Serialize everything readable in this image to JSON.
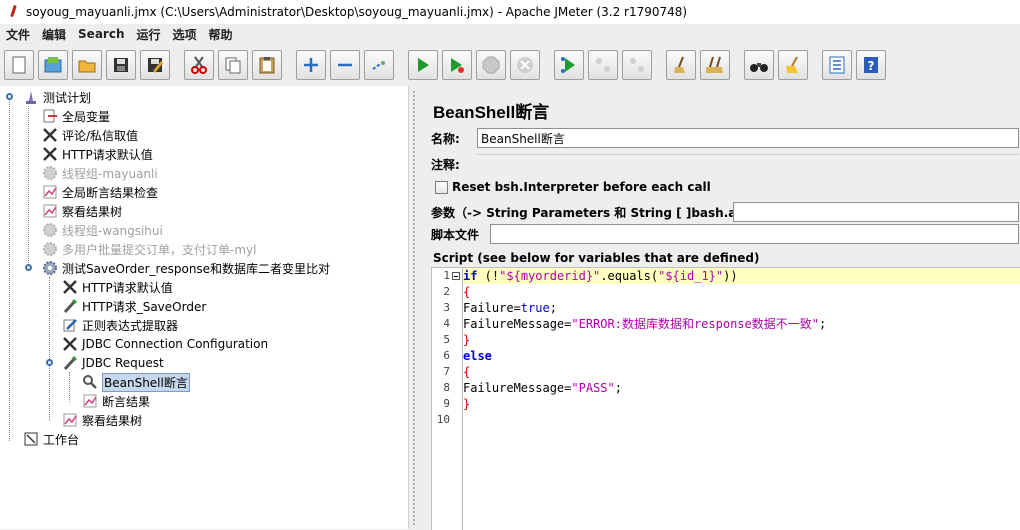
{
  "window": {
    "title": "soyoug_mayuanli.jmx (C:\\Users\\Administrator\\Desktop\\soyoug_mayuanli.jmx) - Apache JMeter (3.2 r1790748)"
  },
  "menu": [
    "文件",
    "编辑",
    "Search",
    "运行",
    "选项",
    "帮助"
  ],
  "toolbar": [
    {
      "icon": "new-icon"
    },
    {
      "icon": "templates-icon"
    },
    {
      "icon": "open-icon"
    },
    {
      "icon": "save-icon"
    },
    {
      "icon": "save-as-icon"
    },
    {
      "icon": "cut-icon"
    },
    {
      "icon": "copy-icon"
    },
    {
      "icon": "paste-icon"
    },
    {
      "icon": "expand-icon"
    },
    {
      "icon": "collapse-icon"
    },
    {
      "icon": "toggle-icon"
    },
    {
      "icon": "start-icon"
    },
    {
      "icon": "start-no-pause-icon"
    },
    {
      "icon": "stop-icon"
    },
    {
      "icon": "shutdown-icon"
    },
    {
      "icon": "remote-start-icon"
    },
    {
      "icon": "remote-stop-icon"
    },
    {
      "icon": "remote-shutdown-icon"
    },
    {
      "icon": "clear-icon"
    },
    {
      "icon": "clear-all-icon"
    },
    {
      "icon": "search-icon"
    },
    {
      "icon": "reset-search-icon"
    },
    {
      "icon": "function-helper-icon"
    },
    {
      "icon": "help-icon"
    }
  ],
  "tree": [
    {
      "label": "测试计划",
      "icon": "test-plan-icon",
      "disabled": false
    },
    {
      "label": "全局变量",
      "icon": "config-element-icon",
      "disabled": false
    },
    {
      "label": "评论/私信取值",
      "icon": "tools-icon",
      "disabled": false
    },
    {
      "label": "HTTP请求默认值",
      "icon": "tools-icon",
      "disabled": false
    },
    {
      "label": "线程组-mayuanli",
      "icon": "thread-group-icon",
      "disabled": true
    },
    {
      "label": "全局断言结果检查",
      "icon": "listener-icon",
      "disabled": false
    },
    {
      "label": "察看结果树",
      "icon": "listener-icon",
      "disabled": false
    },
    {
      "label": "线程组-wangsihui",
      "icon": "thread-group-icon",
      "disabled": true
    },
    {
      "label": "多用户批量提交订单，支付订单-myl",
      "icon": "thread-group-icon",
      "disabled": true
    },
    {
      "label": "测试SaveOrder_response和数据库二者变里比对",
      "icon": "thread-group-icon",
      "disabled": false
    },
    {
      "label": "HTTP请求默认值",
      "icon": "tools-icon",
      "disabled": false
    },
    {
      "label": "HTTP请求_SaveOrder",
      "icon": "sampler-icon",
      "disabled": false
    },
    {
      "label": "正则表达式提取器",
      "icon": "post-processor-icon",
      "disabled": false
    },
    {
      "label": "JDBC Connection Configuration",
      "icon": "tools-icon",
      "disabled": false
    },
    {
      "label": "JDBC Request",
      "icon": "sampler-icon",
      "disabled": false
    },
    {
      "label": "BeanShell断言",
      "icon": "assertion-icon",
      "disabled": false,
      "selected": true
    },
    {
      "label": "断言结果",
      "icon": "listener-icon",
      "disabled": false
    },
    {
      "label": "察看结果树",
      "icon": "listener-icon",
      "disabled": false
    },
    {
      "label": "工作台",
      "icon": "workbench-icon",
      "disabled": false
    }
  ],
  "panel": {
    "title": "BeanShell断言",
    "name_label": "名称:",
    "name_value": "BeanShell断言",
    "comment_label": "注释:",
    "comment_value": "",
    "reset_label": "Reset bsh.Interpreter before each call",
    "params_label": "参数（-> String Parameters 和 String [ ]bash.args）",
    "params_value": "",
    "script_file_label": "脚本文件",
    "script_file_value": "",
    "script_label": "Script (see below for variables that are defined)"
  },
  "script": {
    "line_numbers": [
      "1",
      "2",
      "3",
      "4",
      "5",
      "6",
      "7",
      "8",
      "9",
      "10"
    ],
    "line1": {
      "kw": "if",
      "p1": " (!",
      "s1": "\"${myorderid}\"",
      "p2": ".equals(",
      "s2": "\"${id_1}\"",
      "p3": "))"
    },
    "line2": "{",
    "line3": {
      "a": "Failure=",
      "b": "true",
      "c": ";"
    },
    "line4": {
      "a": "FailureMessage=",
      "b": "\"ERROR:数据库数据和response数据不一致\"",
      "c": ";"
    },
    "line5": "}",
    "line6": "else",
    "line7": "{",
    "line8": {
      "a": "FailureMessage=",
      "b": "\"PASS\"",
      "c": ";"
    },
    "line9": "}",
    "line10": ""
  },
  "colors": {
    "keyword": "#0000cc",
    "string": "#b000b0",
    "brace": "#cc0000",
    "highlight": "#ffffbf",
    "selection": "#c6d8ee"
  }
}
